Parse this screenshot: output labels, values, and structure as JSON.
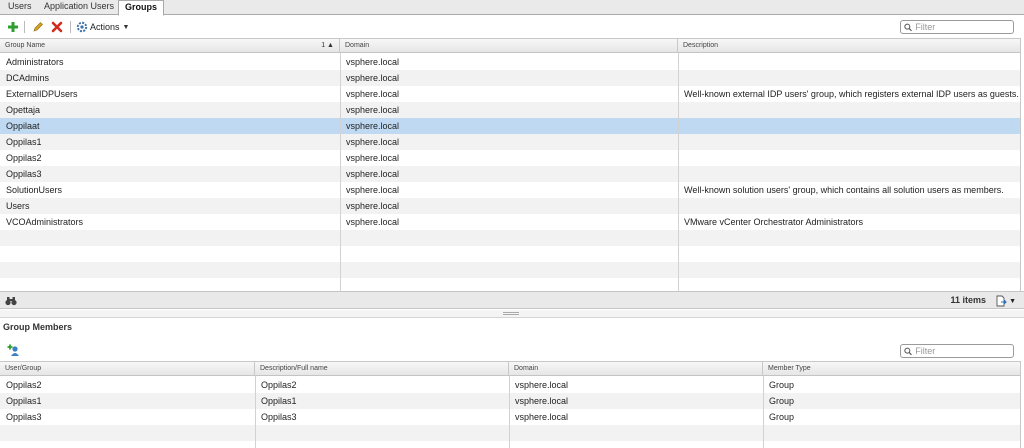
{
  "tabs": [
    "Users",
    "Application Users",
    "Groups"
  ],
  "toolbar": {
    "actions_label": "Actions"
  },
  "groups": {
    "filter_placeholder": "Filter",
    "columns": [
      "Group Name",
      "Domain",
      "Description"
    ],
    "sort_indicator": "1 ▲",
    "selected_index": 4,
    "rows": [
      {
        "name": "Administrators",
        "domain": "vsphere.local",
        "description": ""
      },
      {
        "name": "DCAdmins",
        "domain": "vsphere.local",
        "description": ""
      },
      {
        "name": "ExternalIDPUsers",
        "domain": "vsphere.local",
        "description": "Well-known external IDP users' group, which registers external IDP users as guests."
      },
      {
        "name": "Opettaja",
        "domain": "vsphere.local",
        "description": ""
      },
      {
        "name": "Oppilaat",
        "domain": "vsphere.local",
        "description": ""
      },
      {
        "name": "Oppilas1",
        "domain": "vsphere.local",
        "description": ""
      },
      {
        "name": "Oppilas2",
        "domain": "vsphere.local",
        "description": ""
      },
      {
        "name": "Oppilas3",
        "domain": "vsphere.local",
        "description": ""
      },
      {
        "name": "SolutionUsers",
        "domain": "vsphere.local",
        "description": "Well-known solution users' group, which contains all solution users as members."
      },
      {
        "name": "Users",
        "domain": "vsphere.local",
        "description": ""
      },
      {
        "name": "VCOAdministrators",
        "domain": "vsphere.local",
        "description": "VMware vCenter Orchestrator Administrators"
      }
    ],
    "item_count": "11 items"
  },
  "members": {
    "title": "Group Members",
    "filter_placeholder": "Filter",
    "columns": [
      "User/Group",
      "Description/Full name",
      "Domain",
      "Member Type"
    ],
    "rows": [
      {
        "user": "Oppilas2",
        "fullname": "Oppilas2",
        "domain": "vsphere.local",
        "type": "Group"
      },
      {
        "user": "Oppilas1",
        "fullname": "Oppilas1",
        "domain": "vsphere.local",
        "type": "Group"
      },
      {
        "user": "Oppilas3",
        "fullname": "Oppilas3",
        "domain": "vsphere.local",
        "type": "Group"
      }
    ]
  },
  "colors": {
    "selected_row": "#bfd9f2",
    "add": "#2e9e2e",
    "delete": "#d22a1e",
    "edit": "#d8a21c"
  },
  "icons": [
    "add-icon",
    "edit-icon",
    "delete-icon",
    "actions-gear-icon",
    "search-icon",
    "binoculars-icon",
    "export-icon",
    "add-member-icon"
  ]
}
